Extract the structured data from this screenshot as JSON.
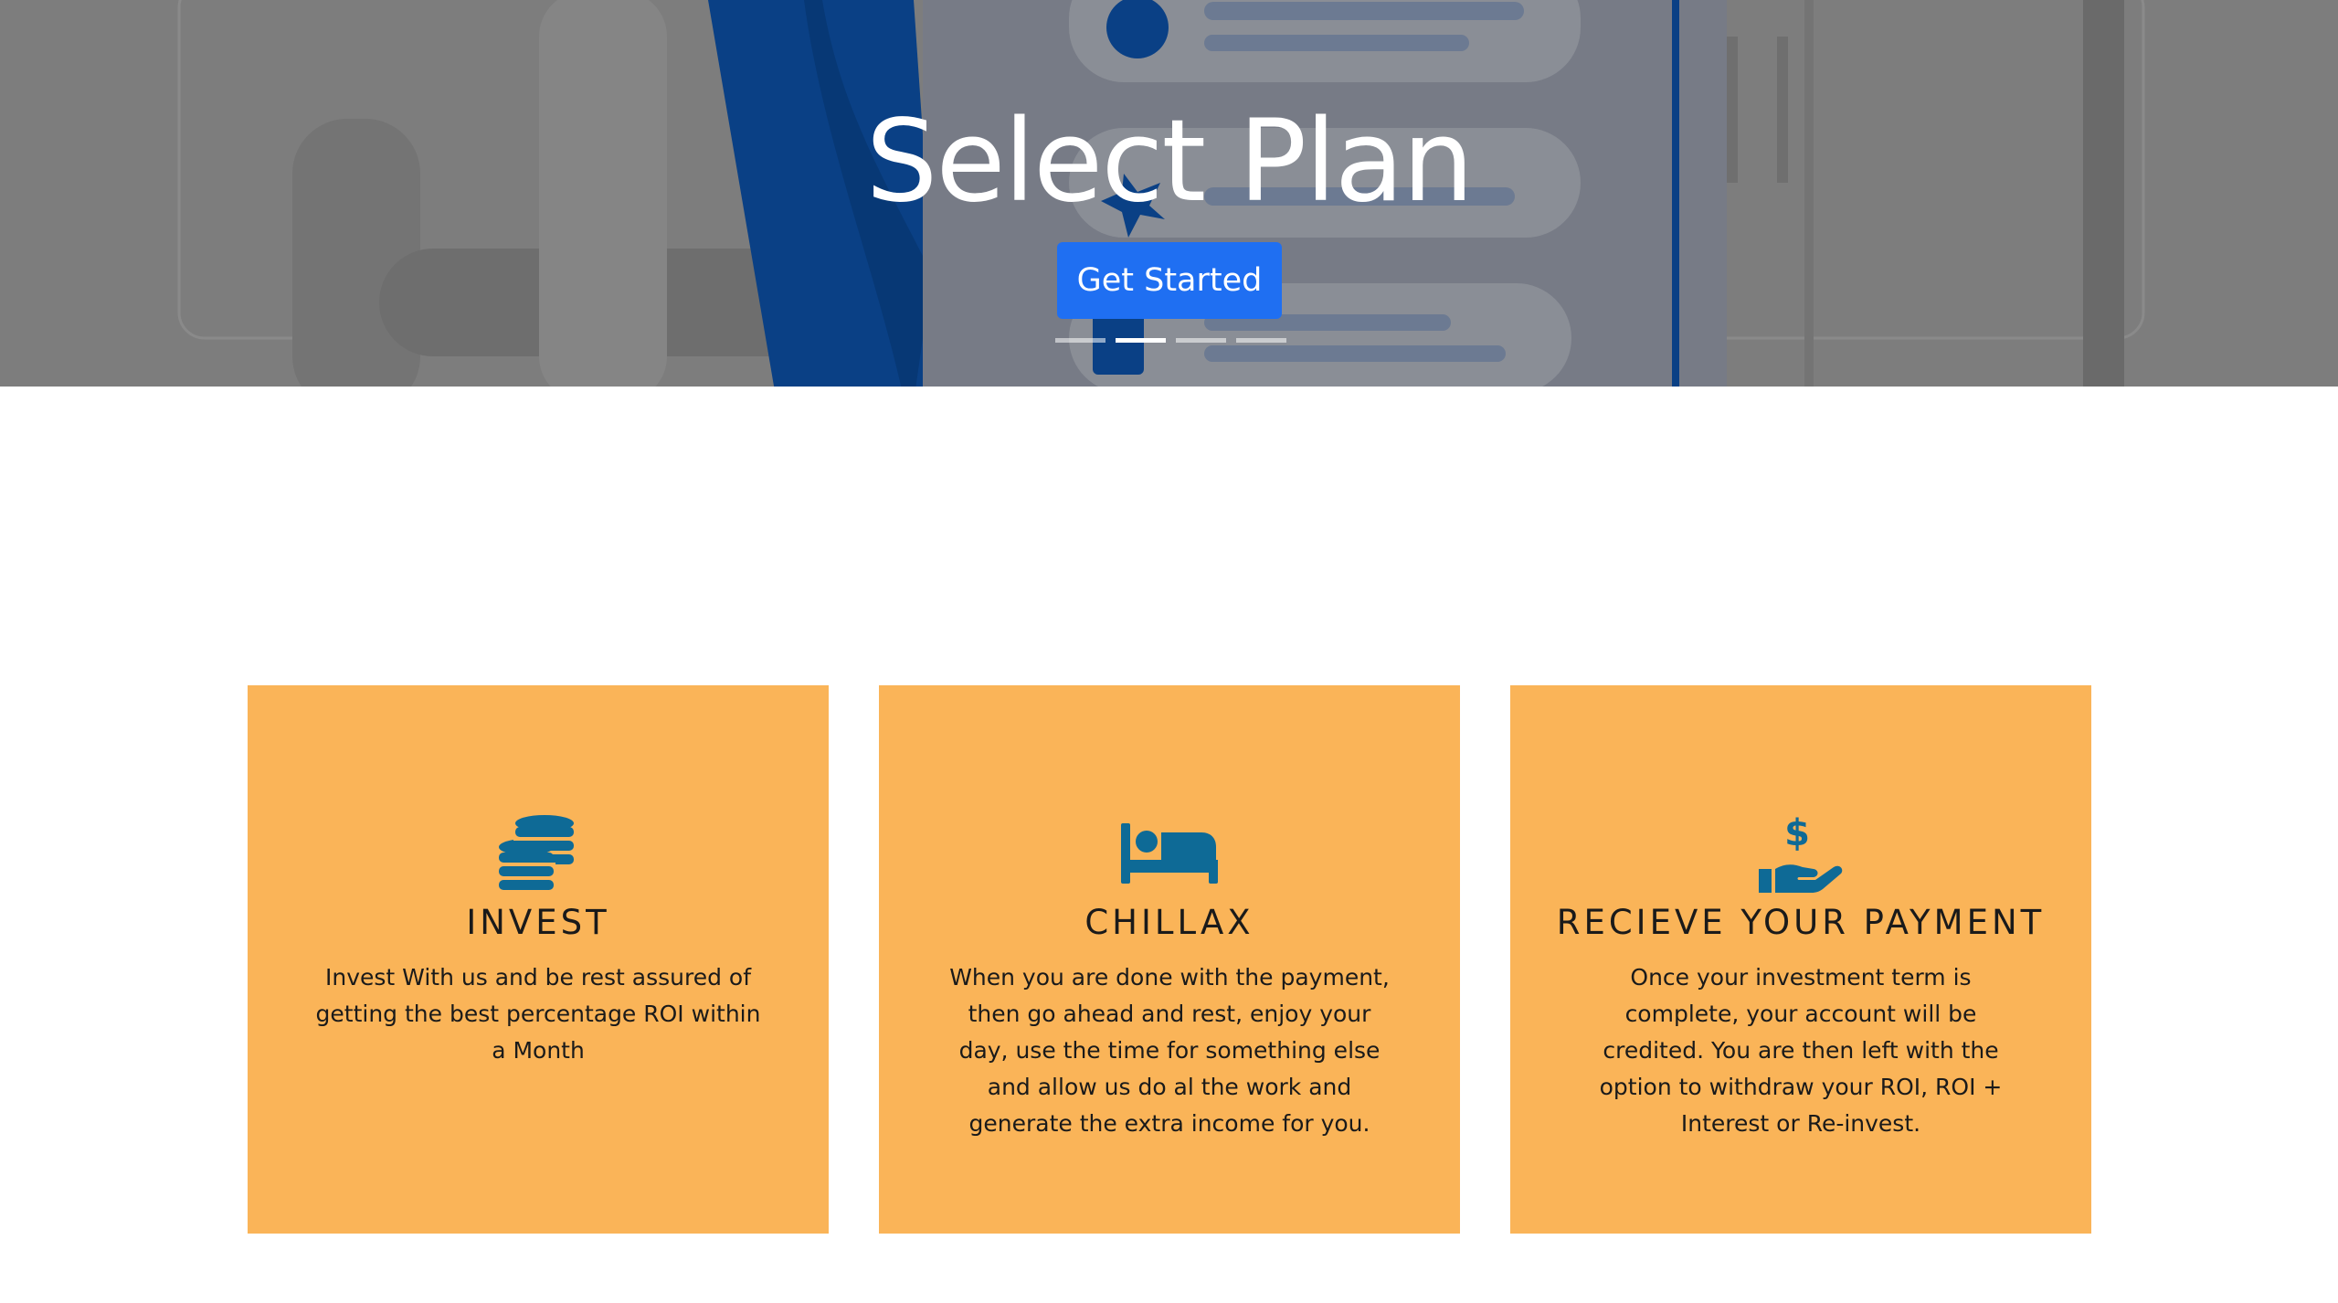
{
  "hero": {
    "title": "Select Plan",
    "button_label": "Get Started",
    "indicators": 4,
    "active_indicator": 2
  },
  "cards": [
    {
      "icon": "coins-icon",
      "title": "INVEST",
      "text": "Invest With us and be rest assured of getting the best percentage ROI within a Month"
    },
    {
      "icon": "bed-icon",
      "title": "CHILLAX",
      "text": "When you are done with the payment, then go ahead and rest, enjoy your day, use the time for something else and allow us do al the work and generate the extra income for you."
    },
    {
      "icon": "hand-dollar-icon",
      "title": "RECIEVE YOUR PAYMENT",
      "text": "Once your investment term is complete, your account will be credited. You are then left with the option to withdraw your ROI, ROI + Interest or Re-invest."
    }
  ],
  "colors": {
    "accent_button": "#1f6ff2",
    "card_background": "#fab458",
    "icon_color": "#0e6a96",
    "hero_overlay": "#7c7c7c"
  }
}
